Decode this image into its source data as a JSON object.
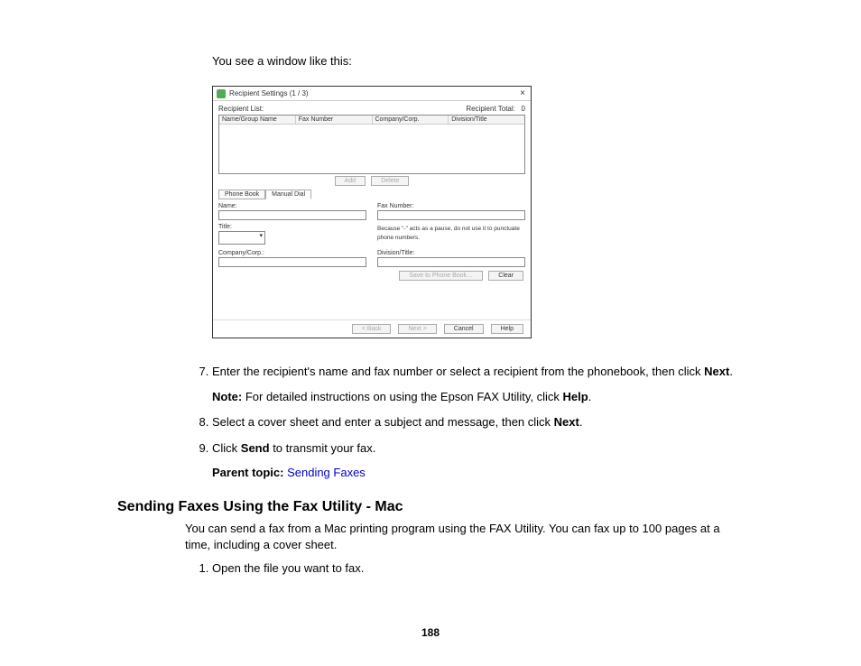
{
  "intro": "You see a window like this:",
  "dialog": {
    "title": "Recipient Settings (1 / 3)",
    "close": "×",
    "recipient_list_label": "Recipient List:",
    "recipient_total_label": "Recipient Total:",
    "recipient_total_value": "0",
    "columns": {
      "name": "Name/Group Name",
      "fax": "Fax Number",
      "company": "Company/Corp.",
      "division": "Division/Title"
    },
    "buttons": {
      "add": "Add",
      "delete": "Delete",
      "save_pb": "Save to Phone Book…",
      "clear": "Clear",
      "back": "< Back",
      "next": "Next >",
      "cancel": "Cancel",
      "help": "Help"
    },
    "tabs": {
      "phone_book": "Phone Book",
      "manual_dial": "Manual Dial"
    },
    "form": {
      "name_label": "Name:",
      "fax_label": "Fax Number:",
      "title_label": "Title:",
      "company_label": "Company/Corp.:",
      "division_label": "Division/Title:",
      "hint": "Because \"-\" acts as a pause, do not use it to punctuate phone numbers."
    }
  },
  "steps": {
    "s7_a": "Enter the recipient's name and fax number or select a recipient from the phonebook, then click ",
    "s7_b": "Next",
    "s7_c": ".",
    "note_label": "Note:",
    "note_text": " For detailed instructions on using the Epson FAX Utility, click ",
    "note_bold": "Help",
    "note_end": ".",
    "s8_a": "Select a cover sheet and enter a subject and message, then click ",
    "s8_b": "Next",
    "s8_c": ".",
    "s9_a": "Click ",
    "s9_b": "Send",
    "s9_c": " to transmit your fax."
  },
  "parent": {
    "label": "Parent topic: ",
    "link": "Sending Faxes"
  },
  "section": {
    "title": "Sending Faxes Using the Fax Utility - Mac",
    "body": "You can send a fax from a Mac printing program using the FAX Utility. You can fax up to 100 pages at a time, including a cover sheet.",
    "step1": "Open the file you want to fax."
  },
  "page_number": "188"
}
